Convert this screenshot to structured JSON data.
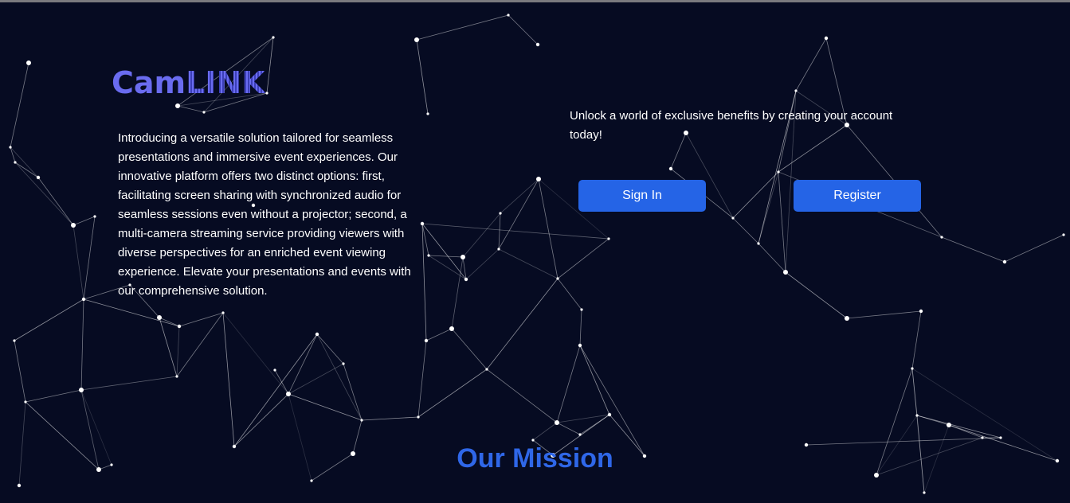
{
  "brand": {
    "logo_part1": "Cam",
    "logo_part2": "LINK",
    "logo_color": "#6a6cf0"
  },
  "intro": {
    "text": "Introducing a versatile solution tailored for seamless presentations and immersive event experiences. Our innovative platform offers two distinct options: first, facilitating screen sharing with synchronized audio for seamless sessions even without a projector; second, a multi-camera streaming service providing viewers with diverse perspectives for an enriched event viewing experience. Elevate your presentations and events with our comprehensive solution."
  },
  "cta": {
    "text": "Unlock a world of exclusive benefits by creating your account today!",
    "signin_label": "Sign In",
    "register_label": "Register",
    "button_color": "#2564e6"
  },
  "mission": {
    "heading": "Our Mission",
    "color": "#2f67e8"
  },
  "theme": {
    "background": "#060b22",
    "network_color": "#ffffff"
  }
}
